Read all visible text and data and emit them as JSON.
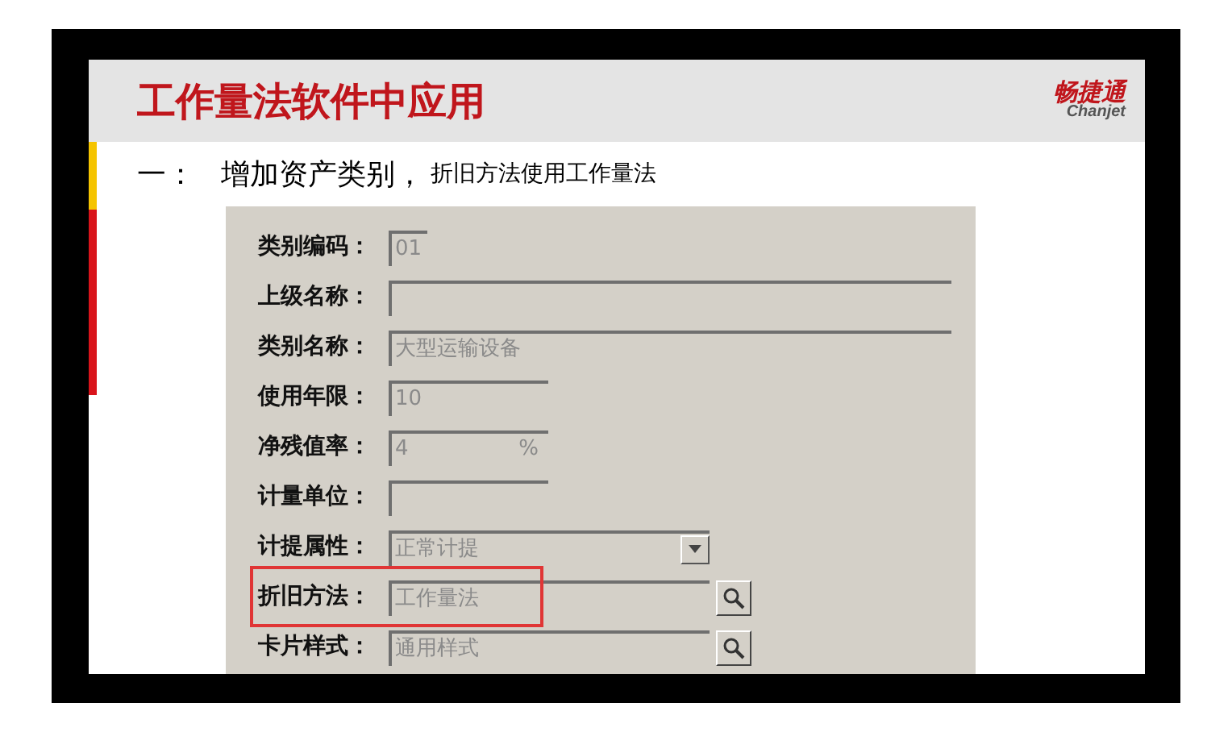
{
  "slide": {
    "title": "工作量法软件中应用",
    "logo": {
      "brand": "畅捷通",
      "latin": "Chanjet"
    },
    "heading": {
      "number": "一：",
      "main": "增加资产类别，",
      "note": "折旧方法使用工作量法"
    }
  },
  "form": {
    "fields": [
      {
        "label": "类别编码：",
        "kind": "text",
        "value": "01",
        "highlighted": false
      },
      {
        "label": "上级名称：",
        "kind": "text",
        "highlighted": false
      },
      {
        "label": "类别名称：",
        "kind": "text",
        "value": "大型运输设备",
        "highlighted": false
      },
      {
        "label": "使用年限：",
        "kind": "text",
        "value": "10",
        "highlighted": false
      },
      {
        "label": "净残值率：",
        "kind": "percent",
        "value": "4",
        "unit": "%",
        "highlighted": false
      },
      {
        "label": "计量单位：",
        "kind": "text",
        "highlighted": false
      },
      {
        "label": "计提属性：",
        "kind": "dropdown",
        "value": "正常计提",
        "highlighted": false
      },
      {
        "label": "折旧方法：",
        "kind": "lookup",
        "value": "工作量法",
        "highlighted": true
      },
      {
        "label": "卡片样式：",
        "kind": "lookup",
        "value": "通用样式",
        "highlighted": false
      }
    ]
  }
}
